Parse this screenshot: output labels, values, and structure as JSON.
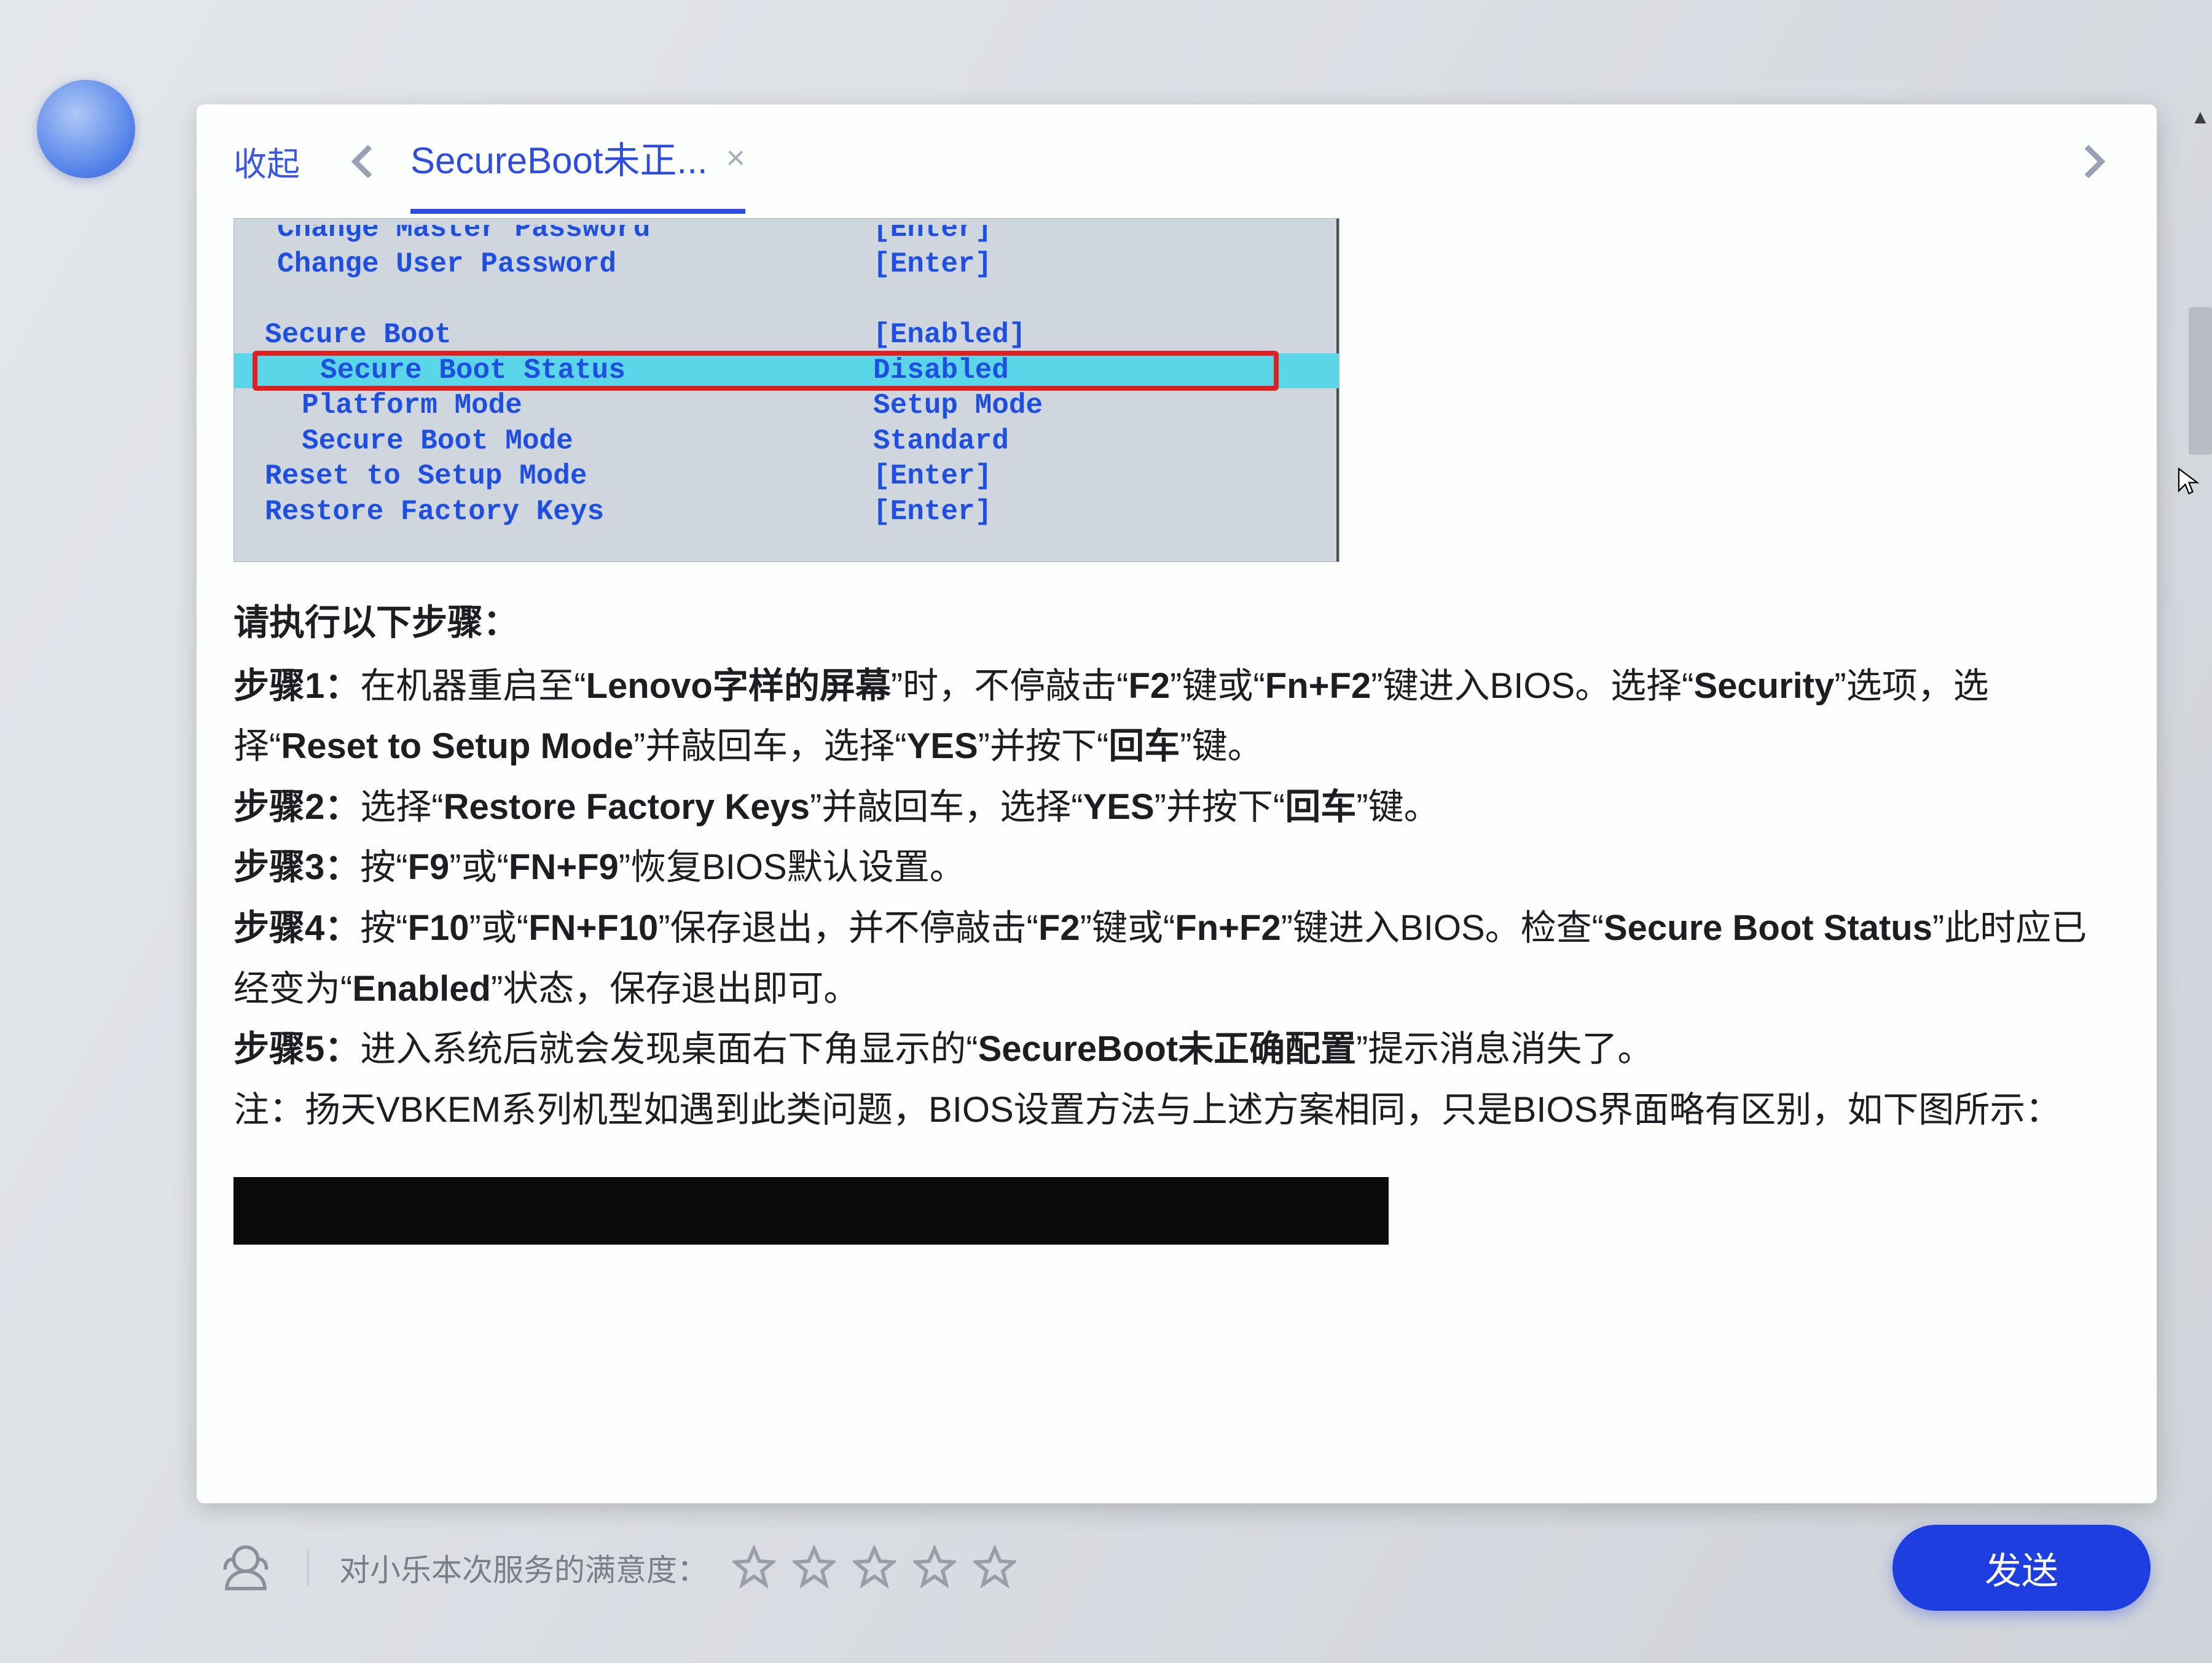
{
  "header": {
    "collapse": "收起",
    "tab_title": "SecureBoot未正...",
    "tab_close": "×"
  },
  "bios": {
    "rows": [
      {
        "label": "Change Master Password",
        "value": "[Enter]",
        "cls": "top cut"
      },
      {
        "label": "Change User Password",
        "value": "[Enter]",
        "cls": "top"
      },
      {
        "label": " ",
        "value": " "
      },
      {
        "label": "Secure Boot",
        "value": "[Enabled]",
        "cls": "noindent"
      },
      {
        "label": "Secure Boot Status",
        "value": "Disabled",
        "cls": "highlight"
      },
      {
        "label": "Platform Mode",
        "value": "Setup Mode"
      },
      {
        "label": "Secure Boot Mode",
        "value": "Standard"
      },
      {
        "label": "Reset to Setup Mode",
        "value": "[Enter]",
        "cls": "noindent"
      },
      {
        "label": "Restore Factory Keys",
        "value": "[Enter]",
        "cls": "noindent"
      }
    ]
  },
  "article": {
    "lead": "请执行以下步骤：",
    "steps": [
      {
        "n": "步骤1：",
        "frags": [
          {
            "t": "在机器重启至“"
          },
          {
            "t": "Lenovo字样的屏幕",
            "b": true
          },
          {
            "t": "”时，不停敲击“"
          },
          {
            "t": "F2",
            "b": true
          },
          {
            "t": "”键或“"
          },
          {
            "t": "Fn+F2",
            "b": true
          },
          {
            "t": "”键进入BIOS。选择“"
          },
          {
            "t": "Security",
            "b": true
          },
          {
            "t": "”选项，选择“"
          },
          {
            "t": "Reset to Setup Mode",
            "b": true
          },
          {
            "t": "”并敲回车，选择“"
          },
          {
            "t": "YES",
            "b": true
          },
          {
            "t": "”并按下“"
          },
          {
            "t": "回车",
            "b": true
          },
          {
            "t": "”键。"
          }
        ]
      },
      {
        "n": "步骤2：",
        "frags": [
          {
            "t": "选择“"
          },
          {
            "t": "Restore Factory Keys",
            "b": true
          },
          {
            "t": "”并敲回车，选择“"
          },
          {
            "t": "YES",
            "b": true
          },
          {
            "t": "”并按下“"
          },
          {
            "t": "回车",
            "b": true
          },
          {
            "t": "”键。"
          }
        ]
      },
      {
        "n": "步骤3：",
        "frags": [
          {
            "t": "按“"
          },
          {
            "t": "F9",
            "b": true
          },
          {
            "t": "”或“"
          },
          {
            "t": "FN+F9",
            "b": true
          },
          {
            "t": "”恢复BIOS默认设置。"
          }
        ]
      },
      {
        "n": "步骤4：",
        "frags": [
          {
            "t": "按“"
          },
          {
            "t": "F10",
            "b": true
          },
          {
            "t": "”或“"
          },
          {
            "t": "FN+F10",
            "b": true
          },
          {
            "t": "”保存退出，并不停敲击“"
          },
          {
            "t": "F2",
            "b": true
          },
          {
            "t": "”键或“"
          },
          {
            "t": "Fn+F2",
            "b": true
          },
          {
            "t": "”键进入BIOS。检查“"
          },
          {
            "t": "Secure Boot Status",
            "b": true
          },
          {
            "t": "”此时应已经变为“"
          },
          {
            "t": "Enabled",
            "b": true
          },
          {
            "t": "”状态，保存退出即可。"
          }
        ]
      },
      {
        "n": "步骤5：",
        "frags": [
          {
            "t": "进入系统后就会发现桌面右下角显示的“"
          },
          {
            "t": "SecureBoot未正确配置",
            "b": true
          },
          {
            "t": "”提示消息消失了。"
          }
        ]
      }
    ],
    "note": "注：扬天VBKEM系列机型如遇到此类问题，BIOS设置方法与上述方案相同，只是BIOS界面略有区别，如下图所示："
  },
  "footer": {
    "rating_label": "对小乐本次服务的满意度：",
    "star_count": 5,
    "send": "发送"
  }
}
